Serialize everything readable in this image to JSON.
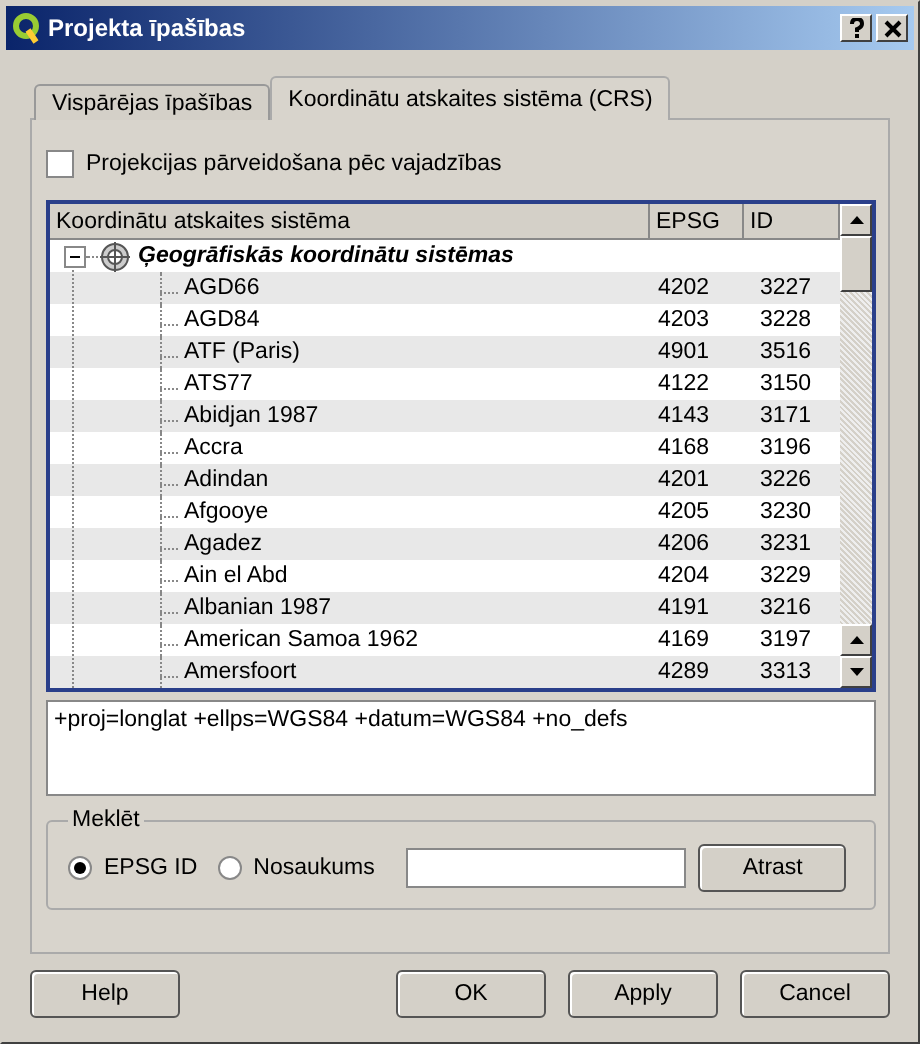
{
  "window": {
    "title": "Projekta īpašības"
  },
  "tabs": [
    {
      "label": "Vispārējas īpašības",
      "selected": false
    },
    {
      "label": "Koordinātu atskaites sistēma (CRS)",
      "selected": true
    }
  ],
  "on_the_fly": {
    "label": "Projekcijas pārveidošana pēc vajadzības",
    "checked": false
  },
  "tree": {
    "columns": [
      "Koordinātu atskaites sistēma",
      "EPSG",
      "ID"
    ],
    "items": [
      {
        "label": "Ģeogrāfiskās koordinātu sistēmas",
        "expanded": true,
        "children": [
          {
            "label": "AGD66",
            "epsg": "4202",
            "id": "3227"
          },
          {
            "label": "AGD84",
            "epsg": "4203",
            "id": "3228"
          },
          {
            "label": "ATF (Paris)",
            "epsg": "4901",
            "id": "3516"
          },
          {
            "label": "ATS77",
            "epsg": "4122",
            "id": "3150"
          },
          {
            "label": "Abidjan 1987",
            "epsg": "4143",
            "id": "3171"
          },
          {
            "label": "Accra",
            "epsg": "4168",
            "id": "3196"
          },
          {
            "label": "Adindan",
            "epsg": "4201",
            "id": "3226"
          },
          {
            "label": "Afgooye",
            "epsg": "4205",
            "id": "3230"
          },
          {
            "label": "Agadez",
            "epsg": "4206",
            "id": "3231"
          },
          {
            "label": "Ain el Abd",
            "epsg": "4204",
            "id": "3229"
          },
          {
            "label": "Albanian 1987",
            "epsg": "4191",
            "id": "3216"
          },
          {
            "label": "American Samoa 1962",
            "epsg": "4169",
            "id": "3197"
          },
          {
            "label": "Amersfoort",
            "epsg": "4289",
            "id": "3313"
          }
        ]
      }
    ]
  },
  "proj_string": "+proj=longlat +ellps=WGS84 +datum=WGS84 +no_defs",
  "search": {
    "title": "Meklēt",
    "options": [
      {
        "label": "EPSG ID",
        "selected": true
      },
      {
        "label": "Nosaukums",
        "selected": false
      }
    ],
    "button": "Atrast"
  },
  "buttons": {
    "help": "Help",
    "ok": "OK",
    "apply": "Apply",
    "cancel": "Cancel"
  }
}
